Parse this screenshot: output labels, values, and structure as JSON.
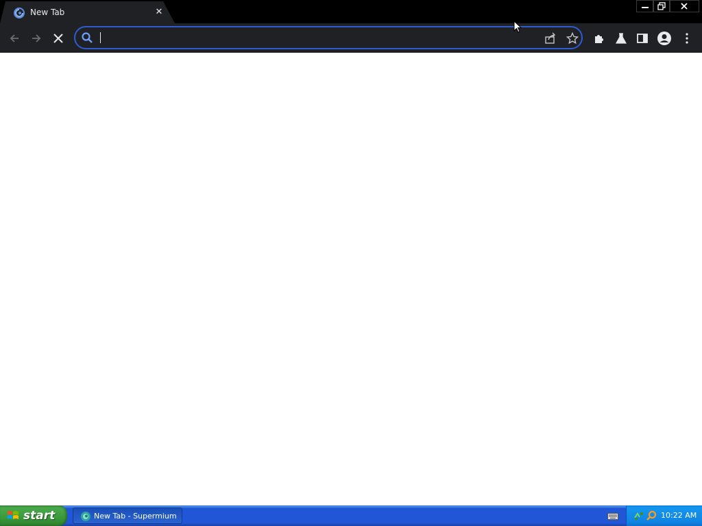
{
  "browser": {
    "tab": {
      "title": "New Tab",
      "favicon": "supermium-icon",
      "close": "close-tab-icon"
    },
    "window_controls": [
      "minimize-icon",
      "restore-icon",
      "close-icon"
    ],
    "toolbar": {
      "back": "back-arrow-icon",
      "forward": "forward-arrow-icon",
      "stop": "stop-loading-icon",
      "omnibox": {
        "value": "",
        "placeholder": "",
        "icon": "search-icon"
      },
      "share": "share-icon",
      "bookmark": "star-icon",
      "extensions": "puzzle-icon",
      "labs": "flask-icon",
      "side_panel": "side-panel-icon",
      "profile": "profile-avatar-icon",
      "menu": "kebab-menu-icon"
    },
    "accent_color": "#2f5bd3",
    "toolbar_color": "#202124"
  },
  "taskbar": {
    "start_label": "start",
    "items": [
      {
        "label": "New Tab - Supermium",
        "icon": "supermium-icon"
      }
    ],
    "clock": "10:22 AM",
    "tray_icons": [
      "keyboard-icon",
      "network-icon",
      "search-icon"
    ]
  }
}
